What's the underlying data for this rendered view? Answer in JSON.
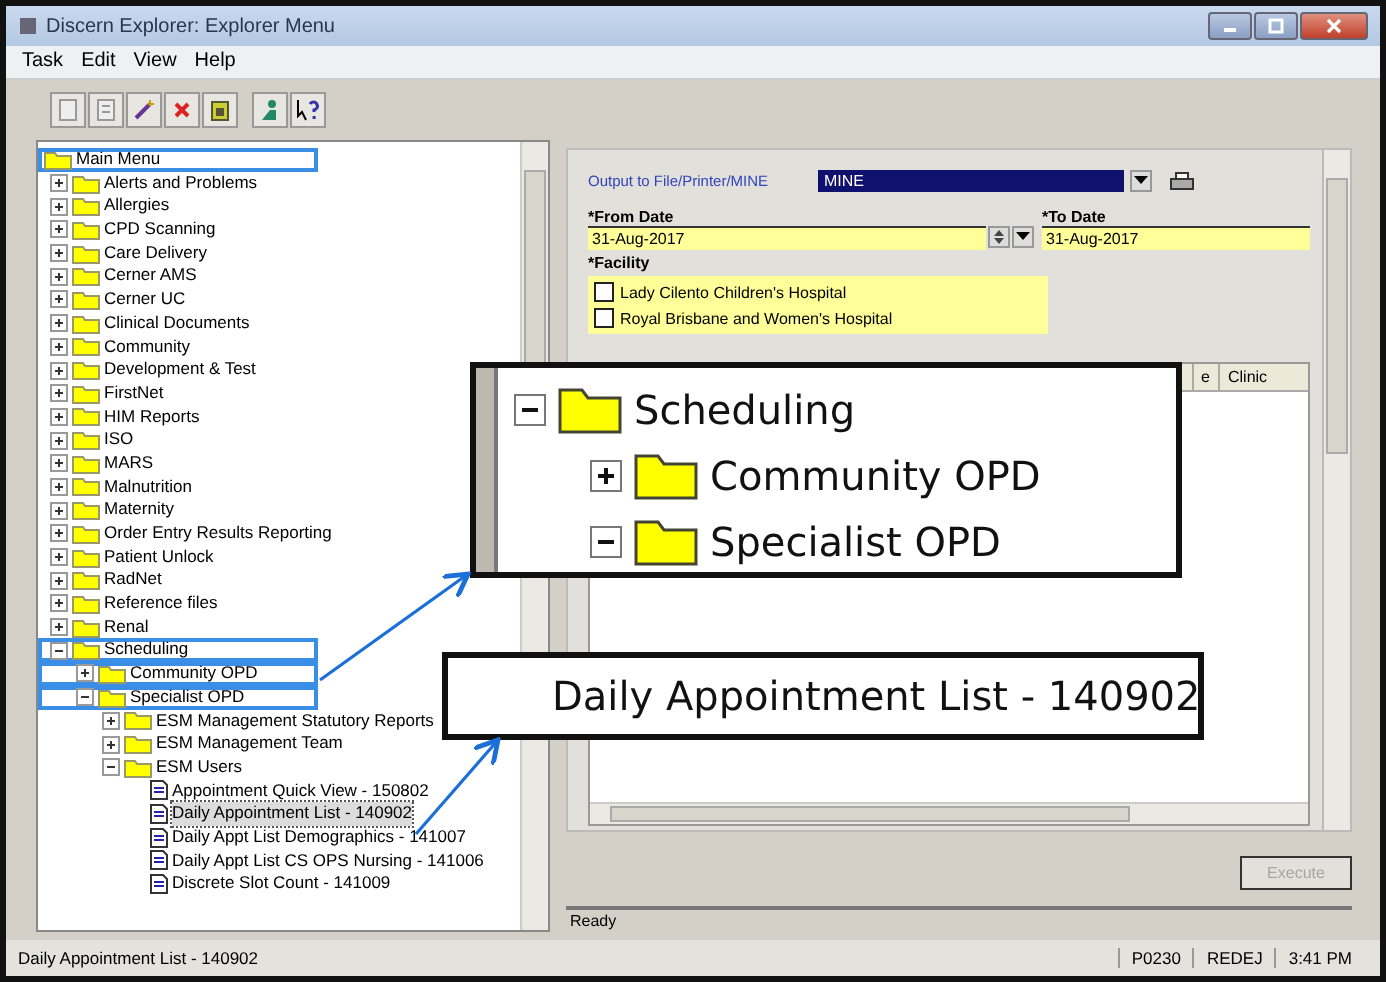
{
  "window": {
    "title": "Discern Explorer: Explorer Menu"
  },
  "menu": [
    "Task",
    "Edit",
    "View",
    "Help"
  ],
  "tree": {
    "label": "Main Menu",
    "kind": "folder",
    "selected": false,
    "highlighted": true,
    "children": [
      {
        "label": "Alerts and Problems",
        "kind": "folder",
        "expanded": false,
        "selected": false,
        "highlighted": false
      },
      {
        "label": "Allergies",
        "kind": "folder",
        "expanded": false,
        "selected": false,
        "highlighted": false
      },
      {
        "label": "CPD Scanning",
        "kind": "folder",
        "expanded": false,
        "selected": false,
        "highlighted": false
      },
      {
        "label": "Care Delivery",
        "kind": "folder",
        "expanded": false,
        "selected": false,
        "highlighted": false
      },
      {
        "label": "Cerner AMS",
        "kind": "folder",
        "expanded": false,
        "selected": false,
        "highlighted": false
      },
      {
        "label": "Cerner UC",
        "kind": "folder",
        "expanded": false,
        "selected": false,
        "highlighted": false
      },
      {
        "label": "Clinical Documents",
        "kind": "folder",
        "expanded": false,
        "selected": false,
        "highlighted": false
      },
      {
        "label": "Community",
        "kind": "folder",
        "expanded": false,
        "selected": false,
        "highlighted": false
      },
      {
        "label": "Development & Test",
        "kind": "folder",
        "expanded": false,
        "selected": false,
        "highlighted": false
      },
      {
        "label": "FirstNet",
        "kind": "folder",
        "expanded": false,
        "selected": false,
        "highlighted": false
      },
      {
        "label": "HIM Reports",
        "kind": "folder",
        "expanded": false,
        "selected": false,
        "highlighted": false
      },
      {
        "label": "ISO",
        "kind": "folder",
        "expanded": false,
        "selected": false,
        "highlighted": false
      },
      {
        "label": "MARS",
        "kind": "folder",
        "expanded": false,
        "selected": false,
        "highlighted": false
      },
      {
        "label": "Malnutrition",
        "kind": "folder",
        "expanded": false,
        "selected": false,
        "highlighted": false
      },
      {
        "label": "Maternity",
        "kind": "folder",
        "expanded": false,
        "selected": false,
        "highlighted": false
      },
      {
        "label": "Order Entry Results Reporting",
        "kind": "folder",
        "expanded": false,
        "selected": false,
        "highlighted": false
      },
      {
        "label": "Patient Unlock",
        "kind": "folder",
        "expanded": false,
        "selected": false,
        "highlighted": false
      },
      {
        "label": "RadNet",
        "kind": "folder",
        "expanded": false,
        "selected": false,
        "highlighted": false
      },
      {
        "label": "Reference files",
        "kind": "folder",
        "expanded": false,
        "selected": false,
        "highlighted": false
      },
      {
        "label": "Renal",
        "kind": "folder",
        "expanded": false,
        "selected": false,
        "highlighted": false
      },
      {
        "label": "Scheduling",
        "kind": "folder",
        "expanded": true,
        "selected": false,
        "highlighted": true,
        "children": [
          {
            "label": "Community OPD",
            "kind": "folder",
            "expanded": false,
            "selected": false,
            "highlighted": true
          },
          {
            "label": "Specialist OPD",
            "kind": "folder",
            "expanded": true,
            "selected": false,
            "highlighted": true,
            "children": [
              {
                "label": "ESM Management Statutory Reports",
                "kind": "folder",
                "expanded": false,
                "selected": false,
                "highlighted": false
              },
              {
                "label": "ESM Management Team",
                "kind": "folder",
                "expanded": false,
                "selected": false,
                "highlighted": false
              },
              {
                "label": "ESM Users",
                "kind": "folder",
                "expanded": true,
                "selected": false,
                "highlighted": false,
                "children": [
                  {
                    "label": "Appointment Quick View - 150802",
                    "kind": "report",
                    "selected": false,
                    "highlighted": false
                  },
                  {
                    "label": "Daily Appointment List - 140902",
                    "kind": "report",
                    "selected": true,
                    "highlighted": false
                  },
                  {
                    "label": "Daily Appt List Demographics - 141007",
                    "kind": "report",
                    "selected": false,
                    "highlighted": false
                  },
                  {
                    "label": "Daily Appt List CS OPS Nursing - 141006",
                    "kind": "report",
                    "selected": false,
                    "highlighted": false
                  },
                  {
                    "label": "Discrete Slot Count - 141009",
                    "kind": "report",
                    "selected": false,
                    "highlighted": false
                  }
                ]
              }
            ]
          }
        ]
      }
    ]
  },
  "form": {
    "output_label": "Output to File/Printer/MINE",
    "output_value": "MINE",
    "from_label": "*From Date",
    "from_value": "31-Aug-2017",
    "to_label": "*To Date",
    "to_value": "31-Aug-2017",
    "facility_label": "*Facility",
    "facilities": [
      {
        "label": "Lady Cilento Children's Hospital",
        "checked": false
      },
      {
        "label": "Royal Brisbane and Women's Hospital",
        "checked": false
      }
    ],
    "columns": [
      "e",
      "Clinic"
    ],
    "execute": {
      "label": "Execute",
      "disabled": true
    },
    "status": "Ready"
  },
  "callouts": [
    {
      "kind": "tree",
      "items": [
        {
          "label": "Scheduling",
          "expanded": true,
          "children": [
            {
              "label": "Community OPD",
              "expanded": false
            },
            {
              "label": "Specialist OPD",
              "expanded": true
            }
          ]
        }
      ]
    },
    {
      "kind": "report",
      "label": "Daily Appointment List - 140902"
    }
  ],
  "status_bar": [
    "Daily Appointment List - 140902",
    "P0230",
    "REDEJ",
    "3:41 PM"
  ]
}
